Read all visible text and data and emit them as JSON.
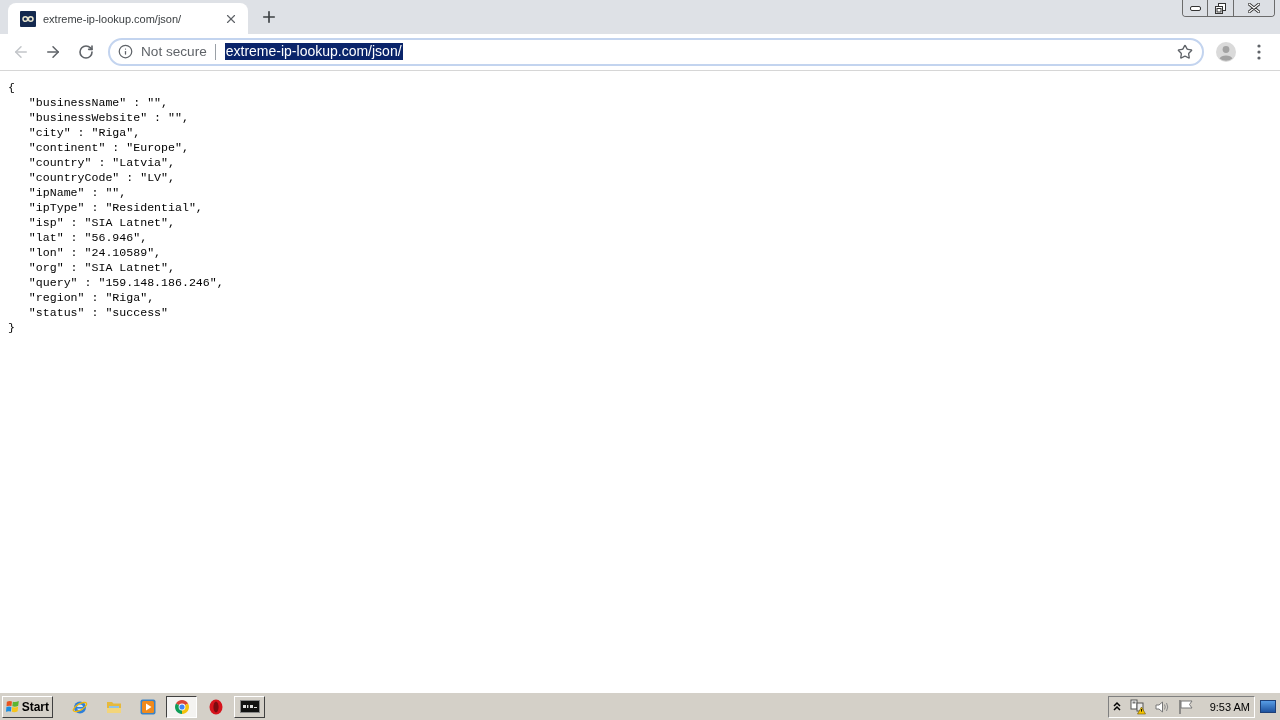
{
  "tabs": [
    {
      "title": "extreme-ip-lookup.com/json/",
      "selected": true
    }
  ],
  "toolbar": {
    "back_disabled": true,
    "address_bar": {
      "security_label": "Not secure",
      "url": "extreme-ip-lookup.com/json/",
      "url_selected": true
    }
  },
  "page": {
    "open": "{",
    "entries": [
      "\"businessName\" : \"\",",
      "\"businessWebsite\" : \"\",",
      "\"city\" : \"Riga\",",
      "\"continent\" : \"Europe\",",
      "\"country\" : \"Latvia\",",
      "\"countryCode\" : \"LV\",",
      "\"ipName\" : \"\",",
      "\"ipType\" : \"Residential\",",
      "\"isp\" : \"SIA Latnet\",",
      "\"lat\" : \"56.946\",",
      "\"lon\" : \"24.10589\",",
      "\"org\" : \"SIA Latnet\",",
      "\"query\" : \"159.148.186.246\",",
      "\"region\" : \"Riga\",",
      "\"status\" : \"success\""
    ],
    "close": "}"
  },
  "taskbar": {
    "start_label": "Start",
    "items": [
      {
        "kind": "pinned",
        "selected": false
      },
      {
        "kind": "pinned",
        "selected": false
      },
      {
        "kind": "pinned",
        "selected": false
      },
      {
        "kind": "running",
        "selected": true
      },
      {
        "kind": "pinned",
        "selected": false
      },
      {
        "kind": "running",
        "selected": false
      }
    ],
    "clock": "9:53 AM"
  }
}
